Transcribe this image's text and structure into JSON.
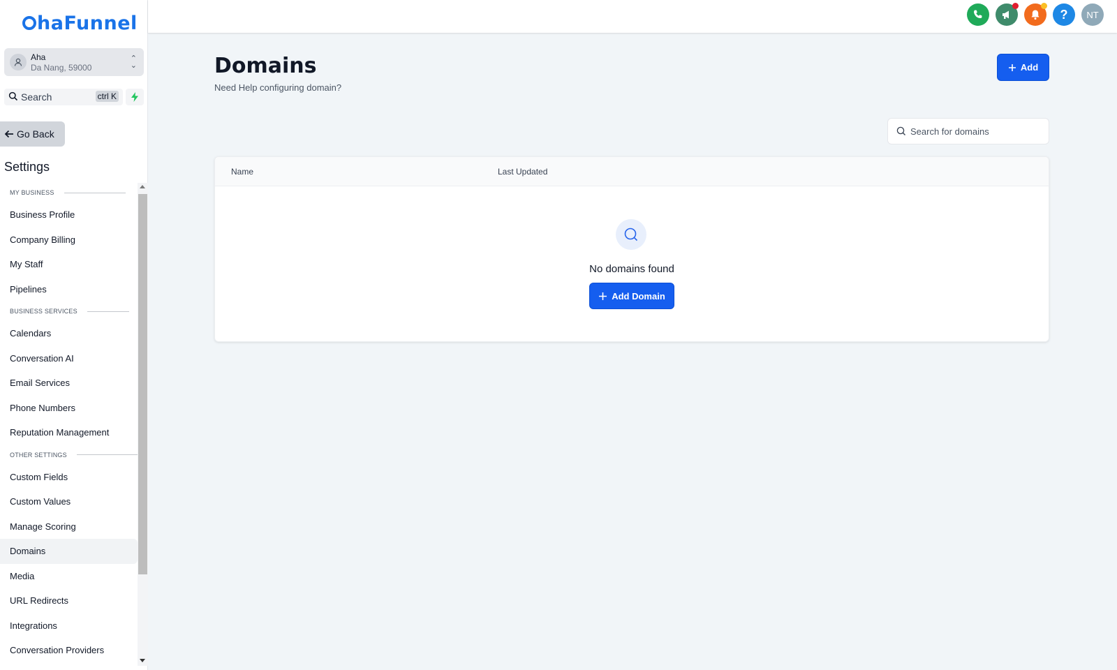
{
  "app": {
    "logo_text": "haFunnel"
  },
  "location": {
    "name": "Aha",
    "address": "Da Nang, 59000"
  },
  "sidebar_search": {
    "label": "Search",
    "shortcut": "ctrl K"
  },
  "go_back": "Go Back",
  "settings_title": "Settings",
  "nav": {
    "section_my_business": "MY BUSINESS",
    "section_business_services": "BUSINESS SERVICES",
    "section_other_settings": "OTHER SETTINGS",
    "business_profile": "Business Profile",
    "company_billing": "Company Billing",
    "my_staff": "My Staff",
    "pipelines": "Pipelines",
    "calendars": "Calendars",
    "conversation_ai": "Conversation AI",
    "email_services": "Email Services",
    "phone_numbers": "Phone Numbers",
    "reputation_management": "Reputation Management",
    "custom_fields": "Custom Fields",
    "custom_values": "Custom Values",
    "manage_scoring": "Manage Scoring",
    "domains": "Domains",
    "media": "Media",
    "url_redirects": "URL Redirects",
    "integrations": "Integrations",
    "conversation_providers": "Conversation Providers",
    "active_item": "Domains"
  },
  "topbar": {
    "user_initials": "NT",
    "icons": [
      "phone-icon",
      "megaphone-icon",
      "bell-icon",
      "help-icon"
    ],
    "colors": {
      "phone": "#1faa59",
      "megaphone": "#3f8b6b",
      "bell": "#f26b1d",
      "help": "#1e88e5",
      "avatar": "#8fa9b8"
    }
  },
  "page": {
    "title": "Domains",
    "subtitle": "Need Help configuring domain?",
    "add_label": "Add",
    "search_placeholder": "Search for domains",
    "columns": [
      "Name",
      "Last Updated"
    ],
    "empty_text": "No domains found",
    "add_domain_label": "Add Domain"
  },
  "colors": {
    "accent": "#155eef",
    "brand": "#1a73e8",
    "background": "#f1f5f8"
  }
}
